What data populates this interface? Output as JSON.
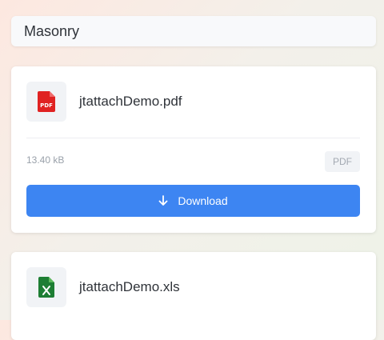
{
  "header": {
    "title": "Masonry"
  },
  "files": [
    {
      "name": "jtattachDemo.pdf",
      "size": "13.40 kB",
      "type": "PDF",
      "icon": "pdf-file-icon",
      "icon_color": "#e02222",
      "download_label": "Download"
    },
    {
      "name": "jtattachDemo.xls",
      "icon": "excel-file-icon",
      "icon_color": "#1e7e34"
    }
  ],
  "colors": {
    "accent": "#3d85f2"
  }
}
